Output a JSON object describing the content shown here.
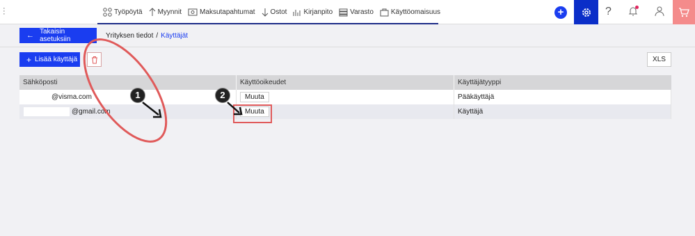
{
  "nav": {
    "items": [
      {
        "label": "Työpöytä",
        "icon": "dashboard-icon"
      },
      {
        "label": "Myynnit",
        "icon": "arrow-up-icon"
      },
      {
        "label": "Maksutapahtumat",
        "icon": "payment-icon"
      },
      {
        "label": "Ostot",
        "icon": "arrow-down-icon"
      },
      {
        "label": "Kirjanpito",
        "icon": "ledger-icon"
      },
      {
        "label": "Varasto",
        "icon": "warehouse-icon"
      },
      {
        "label": "Käyttöomaisuus",
        "icon": "assets-icon"
      }
    ],
    "help_glyph": "?"
  },
  "breadcrumb": {
    "back_label": "Takaisin asetuksiin",
    "parent": "Yrityksen tiedot",
    "separator": "/",
    "current": "Käyttäjät"
  },
  "toolbar": {
    "add_label": "Lisää käyttäjä",
    "xls_label": "XLS"
  },
  "table": {
    "headers": [
      "Sähköposti",
      "Käyttöoikeudet",
      "Käyttäjätyyppi"
    ],
    "rows": [
      {
        "email": "@visma.com",
        "action": "Muuta",
        "type": "Pääkäyttäjä"
      },
      {
        "email": "@gmail.com",
        "action": "Muuta",
        "type": "Käyttäjä"
      }
    ]
  },
  "annotations": {
    "badge1": "1",
    "badge2": "2"
  },
  "colors": {
    "primary": "#1a3df0",
    "nav_active": "#0b2ec8",
    "cart_bg": "#f48b8b",
    "annotation_red": "#e05a5a"
  }
}
